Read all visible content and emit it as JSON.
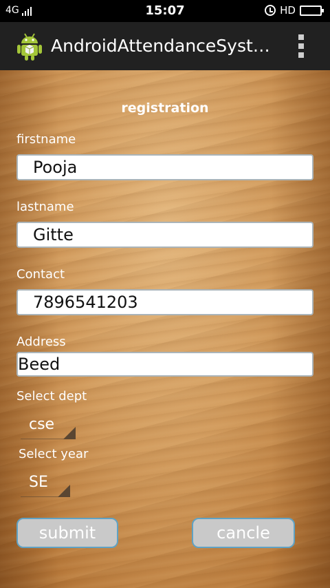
{
  "status_bar": {
    "network": "4G",
    "time": "15:07",
    "hd": "HD"
  },
  "action_bar": {
    "icon": "android-icon",
    "title": "AndroidAttendanceSyst…",
    "menu_icon": "overflow-menu-icon"
  },
  "form": {
    "heading": "registration",
    "firstname": {
      "label": "firstname",
      "value": "Pooja"
    },
    "lastname": {
      "label": "lastname",
      "value": "Gitte"
    },
    "contact": {
      "label": "Contact",
      "value": "7896541203"
    },
    "address": {
      "label": "Address",
      "value": "Beed"
    },
    "dept": {
      "label": "Select dept",
      "selected": "cse"
    },
    "year": {
      "label": "Select year",
      "selected": "SE"
    },
    "submit_label": "submit",
    "cancel_label": "cancle"
  },
  "colors": {
    "button_bg": "#c9c9c9",
    "button_border": "#5fa2c4",
    "action_bar_bg": "#212121",
    "android_green": "#a4c639"
  }
}
